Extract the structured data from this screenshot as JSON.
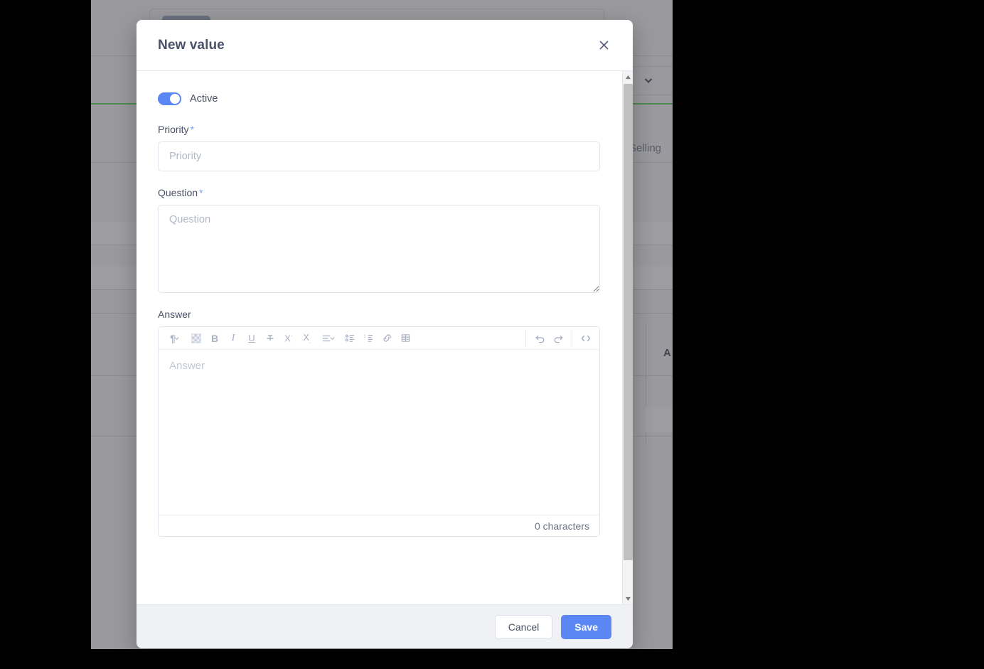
{
  "modal": {
    "title": "New value",
    "close_icon": "close-icon",
    "toggle": {
      "label": "Active",
      "state": "on",
      "accent_color": "#5b87f5"
    },
    "fields": {
      "priority": {
        "label": "Priority",
        "required_marker": "*",
        "value": "",
        "placeholder": "Priority"
      },
      "question": {
        "label": "Question",
        "required_marker": "*",
        "value": "",
        "placeholder": "Question"
      },
      "answer": {
        "label": "Answer",
        "value": "",
        "placeholder": "Answer",
        "character_count": "0 characters"
      }
    },
    "editor_toolbar": [
      {
        "name": "paragraph-format-icon",
        "glyph": "¶",
        "has_caret": true
      },
      {
        "name": "background-color-icon",
        "glyph": "checker",
        "has_caret": false
      },
      {
        "name": "bold-icon",
        "glyph": "B",
        "has_caret": false
      },
      {
        "name": "italic-icon",
        "glyph": "I",
        "has_caret": false
      },
      {
        "name": "underline-icon",
        "glyph": "U",
        "has_caret": false
      },
      {
        "name": "strikethrough-icon",
        "glyph": "S",
        "has_caret": false
      },
      {
        "name": "superscript-icon",
        "glyph": "X·",
        "has_caret": false
      },
      {
        "name": "subscript-icon",
        "glyph": "X.",
        "has_caret": false
      },
      {
        "name": "align-icon",
        "glyph": "≡",
        "has_caret": true
      },
      {
        "name": "bullet-list-icon",
        "glyph": "list",
        "has_caret": false
      },
      {
        "name": "numbered-list-icon",
        "glyph": "1.",
        "has_caret": false
      },
      {
        "name": "insert-link-icon",
        "glyph": "link",
        "has_caret": false
      },
      {
        "name": "insert-table-icon",
        "glyph": "table",
        "has_caret": false
      },
      {
        "name": "undo-icon",
        "glyph": "undo",
        "has_caret": false
      },
      {
        "name": "redo-icon",
        "glyph": "redo",
        "has_caret": false
      },
      {
        "name": "code-view-icon",
        "glyph": "</>",
        "has_caret": false
      }
    ],
    "footer": {
      "cancel_label": "Cancel",
      "save_label": "Save",
      "save_color": "#5b87f5"
    }
  },
  "background": {
    "visible_text": {
      "selling_column": "Selling",
      "table_column_partial": "A"
    },
    "accent_line_color": "#4e8a52",
    "overlay_color": "rgba(0,0,0,0.4)"
  }
}
